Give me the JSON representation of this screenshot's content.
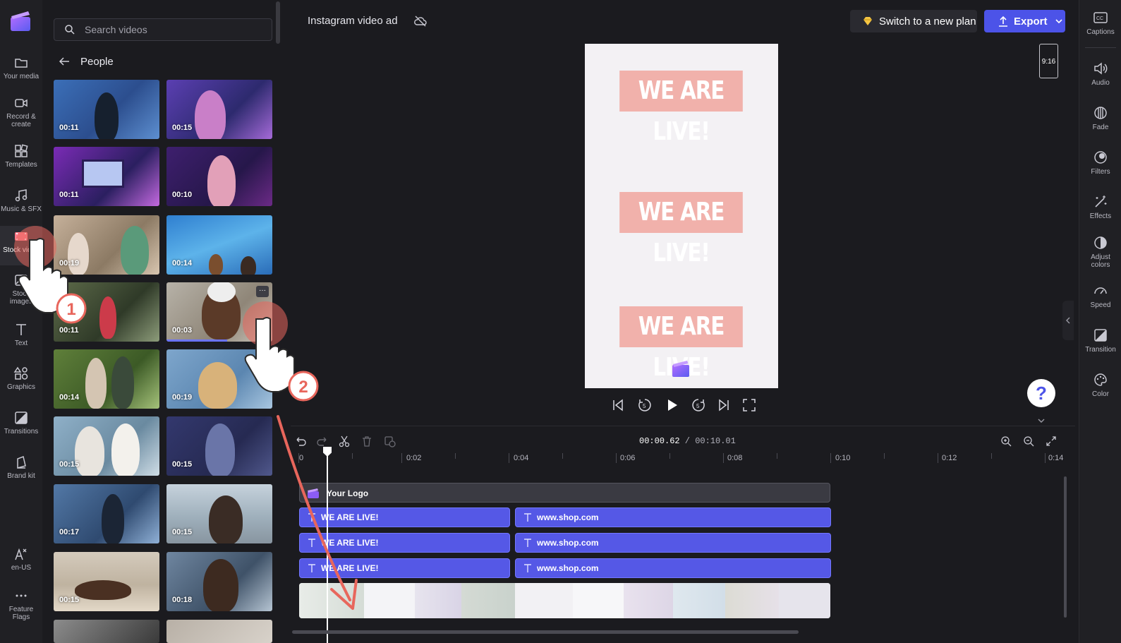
{
  "app": {
    "project_title": "Instagram video ad"
  },
  "left_nav": {
    "items": [
      {
        "label": "Your media",
        "icon": "folder-icon"
      },
      {
        "label": "Record &\ncreate",
        "icon": "camera-icon"
      },
      {
        "label": "Templates",
        "icon": "templates-icon"
      },
      {
        "label": "Music & SFX",
        "icon": "music-icon"
      },
      {
        "label": "Stock video",
        "icon": "film-icon"
      },
      {
        "label": "Stock images",
        "icon": "image-icon"
      },
      {
        "label": "Text",
        "icon": "text-icon"
      },
      {
        "label": "Graphics",
        "icon": "shapes-icon"
      },
      {
        "label": "Transitions",
        "icon": "transitions-icon"
      },
      {
        "label": "Brand kit",
        "icon": "brand-kit-icon"
      },
      {
        "label": "en-US",
        "icon": "language-icon"
      },
      {
        "label": "Feature Flags",
        "icon": "more-icon"
      }
    ]
  },
  "media_panel": {
    "search_placeholder": "Search videos",
    "category": "People",
    "videos": [
      {
        "duration": "00:11"
      },
      {
        "duration": "00:15"
      },
      {
        "duration": "00:11"
      },
      {
        "duration": "00:10"
      },
      {
        "duration": "00:19"
      },
      {
        "duration": "00:14"
      },
      {
        "duration": "00:11"
      },
      {
        "duration": "00:03"
      },
      {
        "duration": "00:14"
      },
      {
        "duration": "00:19"
      },
      {
        "duration": "00:15"
      },
      {
        "duration": "00:15"
      },
      {
        "duration": "00:17"
      },
      {
        "duration": "00:15"
      },
      {
        "duration": "00:15"
      },
      {
        "duration": "00:18"
      }
    ],
    "hover_menu_label": "···"
  },
  "header": {
    "upgrade_label": "Switch to a new plan",
    "export_label": "Export"
  },
  "preview": {
    "text_overlays": [
      "WE ARE LIVE!",
      "WE ARE LIVE!",
      "WE ARE LIVE!"
    ],
    "aspect_ratio": "9:16"
  },
  "help": {
    "label": "?"
  },
  "right_rail": {
    "items": [
      {
        "label": "Captions",
        "icon": "captions-icon"
      },
      {
        "label": "Audio",
        "icon": "speaker-icon"
      },
      {
        "label": "Fade",
        "icon": "fade-icon"
      },
      {
        "label": "Filters",
        "icon": "filters-icon"
      },
      {
        "label": "Effects",
        "icon": "magic-wand-icon"
      },
      {
        "label": "Adjust colors",
        "icon": "contrast-icon"
      },
      {
        "label": "Speed",
        "icon": "speedometer-icon"
      },
      {
        "label": "Transition",
        "icon": "transition-icon"
      },
      {
        "label": "Color",
        "icon": "palette-icon"
      }
    ]
  },
  "timeline": {
    "current_time": "00:00.62",
    "total_time": "00:10.01",
    "time_separator": " / ",
    "ruler_labels": [
      "0",
      "0:02",
      "0:04",
      "0:06",
      "0:08",
      "0:10",
      "0:12",
      "0:14"
    ],
    "logo_track_label": "Your Logo",
    "text_tracks": [
      {
        "left": "WE ARE LIVE!",
        "right": "www.shop.com"
      },
      {
        "left": "WE ARE LIVE!",
        "right": "www.shop.com"
      },
      {
        "left": "WE ARE LIVE!",
        "right": "www.shop.com"
      }
    ]
  },
  "tutorial": {
    "steps": [
      "1",
      "2"
    ]
  },
  "colors": {
    "accent": "#4c53e8",
    "text_track": "#5558e6",
    "tutorial_red": "#e8665c"
  }
}
